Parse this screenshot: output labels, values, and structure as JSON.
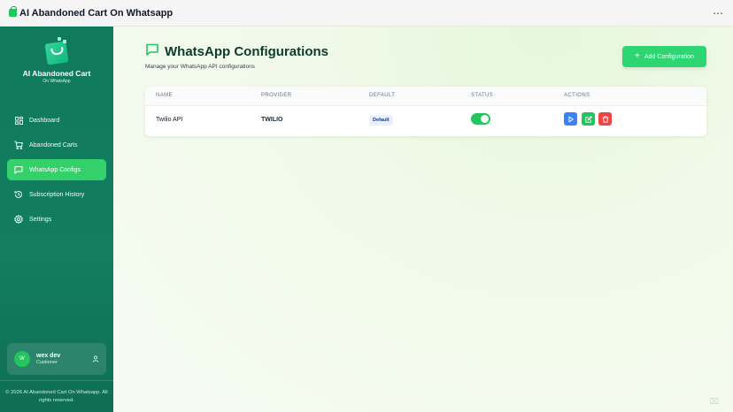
{
  "app": {
    "title": "AI Abandoned Cart On Whatsapp",
    "more_glyph": "⋯"
  },
  "sidebar": {
    "brand_name": "AI Abandoned Cart",
    "brand_sub": "On WhatsApp",
    "items": [
      {
        "label": "Dashboard",
        "icon": "dashboard-icon",
        "active": false
      },
      {
        "label": "Abandoned Carts",
        "icon": "cart-icon",
        "active": false
      },
      {
        "label": "WhatsApp Configs",
        "icon": "chat-icon",
        "active": true
      },
      {
        "label": "Subscription History",
        "icon": "history-icon",
        "active": false
      },
      {
        "label": "Settings",
        "icon": "gear-icon",
        "active": false
      }
    ],
    "user": {
      "initial": "W",
      "name": "wex dev",
      "role": "Customer"
    },
    "copyright": "© 2026 AI Abandoned Cart On Whatsapp. All rights reserved."
  },
  "main": {
    "title": "WhatsApp Configurations",
    "subtitle": "Manage your WhatsApp API configurations",
    "add_button": "Add Configuration",
    "table": {
      "columns": [
        "NAME",
        "PROVIDER",
        "DEFAULT",
        "STATUS",
        "ACTIONS"
      ],
      "rows": [
        {
          "name": "Twilio API",
          "provider": "TWILIO",
          "default": "Default",
          "status_enabled": true
        }
      ]
    }
  },
  "colors": {
    "accent": "#2ed573",
    "sidebar": "#0f7a5c",
    "active_nav": "#34d06a",
    "play": "#3b82f6",
    "edit": "#22c55e",
    "delete": "#ef4444"
  }
}
